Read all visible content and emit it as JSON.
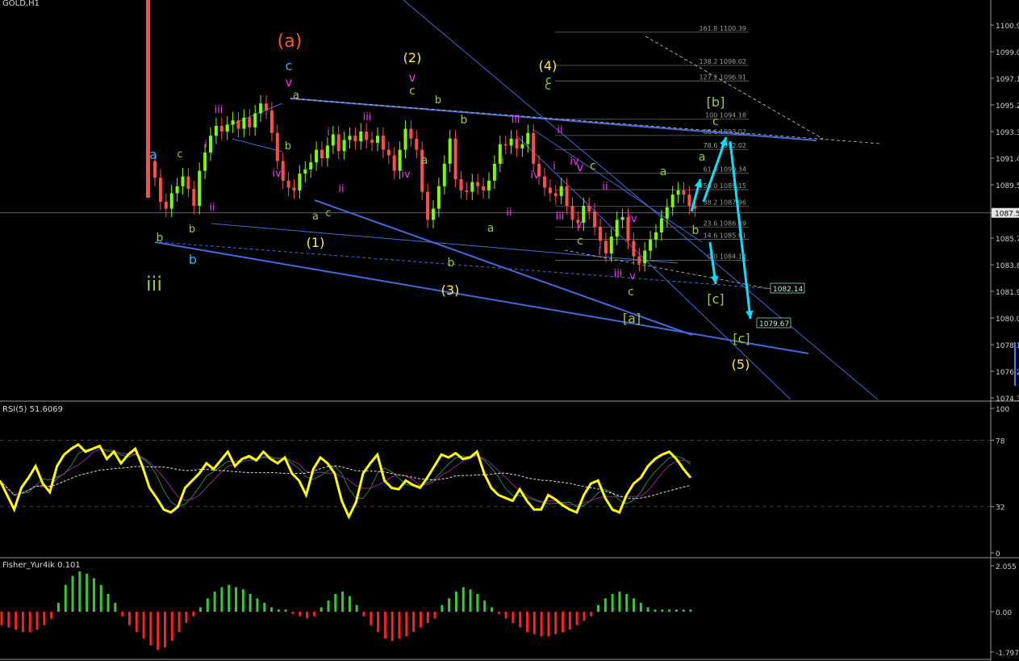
{
  "main_pane": {
    "symbol_label": "GOLD,H1",
    "price_axis_ticks": [
      "1100.9",
      "1099.0",
      "1097.1",
      "1095.2",
      "1093.3",
      "1091.4",
      "1089.5",
      "1087.5",
      "1085.7",
      "1083.8",
      "1081.9",
      "1080.0",
      "1078.1",
      "1076.2",
      "1074.3"
    ],
    "current_price": "1087.5",
    "fib_levels": [
      {
        "pct": "161.8",
        "price": "1100.39"
      },
      {
        "pct": "138.2",
        "price": "1098.02"
      },
      {
        "pct": "127.2",
        "price": "1096.91"
      },
      {
        "pct": "100",
        "price": "1094.18"
      },
      {
        "pct": "88.6",
        "price": "1093.02"
      },
      {
        "pct": "78.6",
        "price": "1092.02"
      },
      {
        "pct": "61.8",
        "price": "1090.34"
      },
      {
        "pct": "50.0",
        "price": "1089.15"
      },
      {
        "pct": "38.2",
        "price": "1087.96"
      },
      {
        "pct": "23.6",
        "price": "1086.49"
      },
      {
        "pct": "14.6",
        "price": "1085.61"
      },
      {
        "pct": "0.0",
        "price": "1084.12"
      }
    ],
    "target_boxes": [
      "1082.14",
      "1079.67"
    ],
    "wave_labels": [
      {
        "t": "(a)",
        "c": "#ff5a1e",
        "s": 22
      },
      {
        "t": "(1)",
        "c": "#ffee33",
        "s": 16
      },
      {
        "t": "(2)",
        "c": "#ffee33",
        "s": 16
      },
      {
        "t": "(3)",
        "c": "#ffee33",
        "s": 16
      },
      {
        "t": "(4)",
        "c": "#ffee33",
        "s": 16
      },
      {
        "t": "(5)",
        "c": "#ffee33",
        "s": 16
      },
      {
        "t": "[a]",
        "c": "#9acd32",
        "s": 16
      },
      {
        "t": "[b]",
        "c": "#9acd32",
        "s": 16
      },
      {
        "t": "[c]",
        "c": "#9acd32",
        "s": 16
      },
      {
        "t": "[c]",
        "c": "#9acd32",
        "s": 16
      },
      {
        "t": "iii",
        "c": "#9acd32",
        "s": 24
      },
      {
        "t": "a",
        "c": "#29b6f6",
        "s": 16
      },
      {
        "t": "b",
        "c": "#29b6f6",
        "s": 16
      },
      {
        "t": "c",
        "c": "#29b6f6",
        "s": 16
      },
      {
        "t": "v",
        "c": "#ff33ff",
        "s": 15
      },
      {
        "t": "a",
        "c": "#9acd32",
        "s": 13
      },
      {
        "t": "b",
        "c": "#9acd32",
        "s": 13
      },
      {
        "t": "c",
        "c": "#9acd32",
        "s": 13
      },
      {
        "t": "b",
        "c": "#9acd32",
        "s": 13
      },
      {
        "t": "a",
        "c": "#9acd32",
        "s": 13
      },
      {
        "t": "c",
        "c": "#9acd32",
        "s": 13
      },
      {
        "t": "b",
        "c": "#9acd32",
        "s": 13
      },
      {
        "t": "v",
        "c": "#ff33ff",
        "s": 15
      },
      {
        "t": "c",
        "c": "#9acd32",
        "s": 14
      },
      {
        "t": "b",
        "c": "#9acd32",
        "s": 14
      },
      {
        "t": "a",
        "c": "#9acd32",
        "s": 14
      },
      {
        "t": "a",
        "c": "#9acd32",
        "s": 14
      },
      {
        "t": "b",
        "c": "#9acd32",
        "s": 14
      },
      {
        "t": "c",
        "c": "#9acd32",
        "s": 14
      },
      {
        "t": "c",
        "c": "#9acd32",
        "s": 14
      },
      {
        "t": "v",
        "c": "#ff33ff",
        "s": 15
      },
      {
        "t": "c",
        "c": "#9acd32",
        "s": 14
      },
      {
        "t": "c",
        "c": "#9acd32",
        "s": 14
      },
      {
        "t": "a",
        "c": "#9acd32",
        "s": 14
      },
      {
        "t": "b",
        "c": "#9acd32",
        "s": 14
      },
      {
        "t": "c",
        "c": "#9acd32",
        "s": 14
      },
      {
        "t": "b",
        "c": "#9acd32",
        "s": 14
      },
      {
        "t": "a",
        "c": "#9acd32",
        "s": 14
      },
      {
        "t": "c",
        "c": "#9acd32",
        "s": 14
      },
      {
        "t": "iii",
        "c": "#ff33ff",
        "s": 13
      },
      {
        "t": "i",
        "c": "#ff33ff",
        "s": 13
      },
      {
        "t": "ii",
        "c": "#ff33ff",
        "s": 13
      },
      {
        "t": "iv",
        "c": "#ff33ff",
        "s": 13
      },
      {
        "t": "i",
        "c": "#ff33ff",
        "s": 13
      },
      {
        "t": "ii",
        "c": "#ff33ff",
        "s": 13
      },
      {
        "t": "iii",
        "c": "#ff33ff",
        "s": 13
      },
      {
        "t": "iv",
        "c": "#ff33ff",
        "s": 13
      },
      {
        "t": "iii",
        "c": "#ff33ff",
        "s": 13
      },
      {
        "t": "i",
        "c": "#ff33ff",
        "s": 13
      },
      {
        "t": "ii",
        "c": "#ff33ff",
        "s": 13
      },
      {
        "t": "iv",
        "c": "#ff33ff",
        "s": 13
      },
      {
        "t": "ii",
        "c": "#ff33ff",
        "s": 13
      },
      {
        "t": "i",
        "c": "#ff33ff",
        "s": 13
      },
      {
        "t": "iii",
        "c": "#ff33ff",
        "s": 13
      },
      {
        "t": "v",
        "c": "#ff33ff",
        "s": 13
      },
      {
        "t": "iv",
        "c": "#ff33ff",
        "s": 13
      },
      {
        "t": "ii",
        "c": "#ff33ff",
        "s": 13
      },
      {
        "t": "i",
        "c": "#ff33ff",
        "s": 13
      },
      {
        "t": "iii",
        "c": "#ff33ff",
        "s": 13
      },
      {
        "t": "iv",
        "c": "#ff33ff",
        "s": 13
      },
      {
        "t": "v",
        "c": "#ff33ff",
        "s": 13
      }
    ]
  },
  "rsi_pane": {
    "label": "RSI(5) 51.6069",
    "ticks": [
      "100",
      "78",
      "32",
      "0"
    ]
  },
  "fisher_pane": {
    "label": "Fisher_Yur4ik 0.101",
    "ticks": [
      "2.055",
      "0.00",
      "-1.797"
    ]
  },
  "colors": {
    "bull_candle": "#7cfc00",
    "bear_candle": "#ff4d4d",
    "trendline": "#4169e1",
    "arrow": "#00e5ff",
    "rsi_line": "#ffff00"
  },
  "chart_data": [
    {
      "type": "candlestick",
      "title": "GOLD,H1",
      "ylim": [
        1074.3,
        1101.5
      ],
      "close": [
        1090.0,
        1088.3,
        1087.8,
        1088.9,
        1089.4,
        1090.1,
        1089.2,
        1088.0,
        1090.5,
        1091.8,
        1093.0,
        1093.7,
        1093.3,
        1093.8,
        1094.1,
        1093.5,
        1094.3,
        1093.6,
        1094.6,
        1095.3,
        1094.8,
        1093.2,
        1091.2,
        1089.8,
        1089.3,
        1089.1,
        1090.3,
        1090.6,
        1091.1,
        1092.0,
        1091.4,
        1092.3,
        1093.1,
        1091.9,
        1092.7,
        1093.0,
        1092.6,
        1093.3,
        1092.7,
        1092.5,
        1093.0,
        1092.0,
        1091.6,
        1090.5,
        1092.0,
        1093.5,
        1092.8,
        1092.0,
        1089.0,
        1087.0,
        1087.8,
        1089.4,
        1091.0,
        1092.8,
        1089.9,
        1089.1,
        1089.0,
        1089.7,
        1089.4,
        1089.1,
        1089.8,
        1091.0,
        1092.4,
        1092.3,
        1092.8,
        1092.1,
        1092.4,
        1093.2,
        1091.0,
        1090.1,
        1089.3,
        1088.9,
        1088.7,
        1089.4,
        1088.0,
        1087.0,
        1086.8,
        1088.0,
        1087.6,
        1086.5,
        1085.5,
        1084.6,
        1085.8,
        1087.0,
        1087.2,
        1085.5,
        1084.4,
        1083.9,
        1084.8,
        1085.6,
        1086.1,
        1087.1,
        1087.9,
        1088.8,
        1089.1,
        1088.8,
        1088.0,
        1087.8
      ],
      "series": [
        {
          "name": "RSI(5)",
          "values": [
            50,
            40,
            30,
            45,
            52,
            60,
            48,
            42,
            60,
            68,
            72,
            75,
            70,
            72,
            74,
            65,
            70,
            62,
            68,
            72,
            60,
            45,
            38,
            30,
            28,
            32,
            45,
            50,
            55,
            62,
            58,
            64,
            70,
            60,
            65,
            67,
            64,
            70,
            65,
            62,
            66,
            55,
            50,
            40,
            58,
            66,
            62,
            55,
            36,
            25,
            35,
            55,
            62,
            68,
            50,
            45,
            44,
            50,
            47,
            45,
            52,
            60,
            68,
            66,
            69,
            65,
            66,
            70,
            55,
            45,
            40,
            38,
            36,
            44,
            36,
            30,
            30,
            40,
            37,
            33,
            30,
            28,
            40,
            48,
            50,
            38,
            30,
            28,
            40,
            48,
            52,
            60,
            65,
            68,
            70,
            65,
            58,
            52
          ]
        },
        {
          "name": "Fisher_Yur4ik",
          "values": [
            -0.6,
            -0.7,
            -0.8,
            -0.9,
            -0.9,
            -0.8,
            -0.6,
            -0.3,
            0.4,
            1.2,
            1.6,
            1.8,
            1.7,
            1.5,
            1.2,
            0.8,
            0.4,
            -0.2,
            -0.6,
            -0.9,
            -1.2,
            -1.5,
            -1.7,
            -1.6,
            -1.3,
            -0.9,
            -0.5,
            -0.2,
            0.2,
            0.6,
            0.9,
            1.1,
            1.2,
            1.1,
            1.0,
            0.8,
            0.6,
            0.4,
            0.2,
            0.1,
            0.1,
            -0.1,
            -0.2,
            -0.3,
            -0.2,
            0.2,
            0.5,
            0.8,
            0.9,
            0.7,
            0.3,
            -0.2,
            -0.6,
            -0.9,
            -1.2,
            -1.3,
            -1.2,
            -1.1,
            -0.9,
            -0.7,
            -0.5,
            -0.3,
            0.3,
            0.6,
            0.9,
            1.1,
            1.0,
            0.8,
            0.5,
            0.2,
            -0.1,
            -0.3,
            -0.5,
            -0.7,
            -0.9,
            -1.0,
            -1.1,
            -1.1,
            -1.0,
            -0.9,
            -0.8,
            -0.6,
            -0.4,
            -0.2,
            0.3,
            0.6,
            0.8,
            0.9,
            0.8,
            0.6,
            0.4,
            0.2,
            0.1,
            0.1,
            0.1,
            0.1,
            0.1,
            0.1
          ]
        }
      ]
    }
  ]
}
